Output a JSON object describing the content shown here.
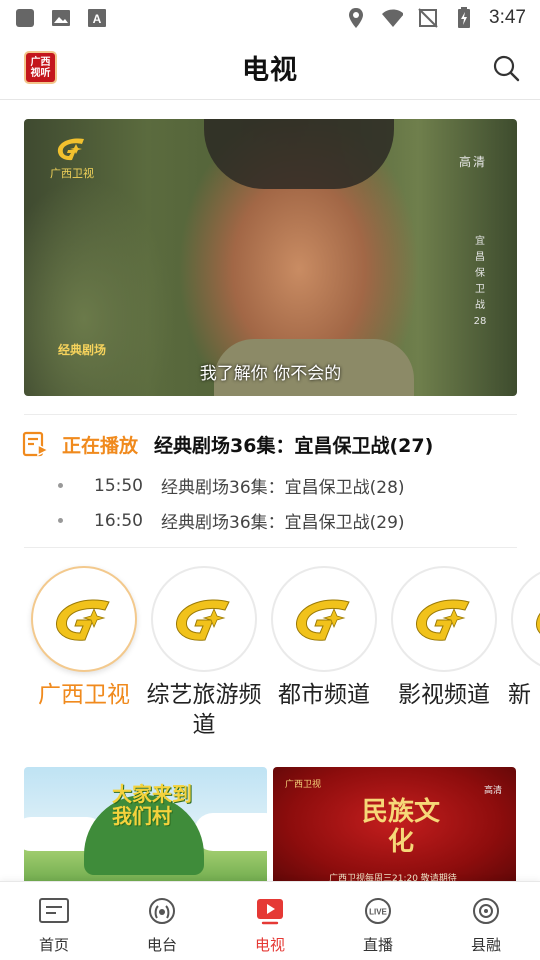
{
  "status_bar": {
    "time": "3:47"
  },
  "header": {
    "title": "电视",
    "logo_text": "广西视听"
  },
  "video": {
    "channel_logo_text": "广西卫视",
    "quality": "高清",
    "vertical_title": "宜昌保卫战28",
    "theater_logo": "经典剧场",
    "subtitle": "我了解你 你不会的"
  },
  "now_playing": {
    "label": "正在播放",
    "title": "经典剧场36集：宜昌保卫战(27)",
    "schedule": [
      {
        "time": "15:50",
        "title": "经典剧场36集：宜昌保卫战(28)"
      },
      {
        "time": "16:50",
        "title": "经典剧场36集：宜昌保卫战(29)"
      }
    ]
  },
  "channels": [
    {
      "name": "广西卫视",
      "active": true
    },
    {
      "name": "综艺旅游频道",
      "active": false
    },
    {
      "name": "都市频道",
      "active": false
    },
    {
      "name": "影视频道",
      "active": false
    },
    {
      "name": "新",
      "active": false
    }
  ],
  "cards": [
    {
      "title": "大家来到我们村"
    },
    {
      "badge": "广西卫视",
      "quality": "高清",
      "title": "民族文化",
      "note": "广西卫视每周三21:20 敬请期待"
    }
  ],
  "bottom_nav": [
    {
      "label": "首页",
      "icon": "home-icon"
    },
    {
      "label": "电台",
      "icon": "radio-icon"
    },
    {
      "label": "电视",
      "icon": "tv-icon",
      "active": true
    },
    {
      "label": "直播",
      "icon": "live-icon"
    },
    {
      "label": "县融",
      "icon": "county-icon"
    }
  ],
  "colors": {
    "accent": "#f08a1d",
    "active_nav": "#e53935",
    "logo_red": "#c4161c"
  }
}
